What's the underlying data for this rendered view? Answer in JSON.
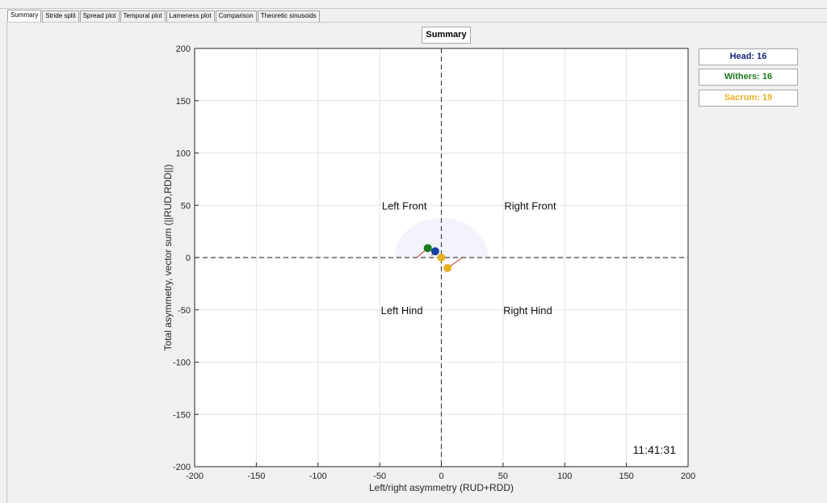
{
  "tabs": [
    {
      "label": "Summary",
      "active": true
    },
    {
      "label": "Stride split"
    },
    {
      "label": "Spread plot"
    },
    {
      "label": "Temporal plot"
    },
    {
      "label": "Lameness plot"
    },
    {
      "label": "Comparison"
    },
    {
      "label": "Theoretic sinusoids"
    }
  ],
  "plot_title": "Summary",
  "legend": [
    {
      "label": "Head: 16",
      "color": "#1a237e"
    },
    {
      "label": "Withers: 16",
      "color": "#1b7a1b"
    },
    {
      "label": "Sacrum: 19",
      "color": "#e8b020"
    }
  ],
  "quadrants": {
    "left_front": "Left Front",
    "right_front": "Right Front",
    "left_hind": "Left Hind",
    "right_hind": "Right Hind"
  },
  "timestamp": "11:41:31",
  "chart_data": {
    "type": "scatter",
    "title": "Summary",
    "xlabel": "Left/right asymmetry (RUD+RDD)",
    "ylabel": "Total asymmetry, vector sum (||RUD,RDD||)",
    "xlim": [
      -200,
      200
    ],
    "ylim": [
      -200,
      200
    ],
    "ticks": [
      -200,
      -150,
      -100,
      -50,
      0,
      50,
      100,
      150,
      200
    ],
    "grid": true,
    "series": [
      {
        "name": "Withers: 16",
        "color": "#1b7a1b",
        "x": -11,
        "y": 9
      },
      {
        "name": "Head: 16",
        "color": "#1440a0",
        "x": -5,
        "y": 6
      },
      {
        "name": "Sacrum: 19",
        "color": "#e8b020",
        "points": [
          {
            "x": 0,
            "y": 0
          },
          {
            "x": 5,
            "y": -10
          }
        ]
      }
    ],
    "threshold_radius": 38,
    "colors": {
      "threshold_fill": "#f2f3fb",
      "dashed_axes": "#444444",
      "vector_line": "#c0392b"
    }
  }
}
